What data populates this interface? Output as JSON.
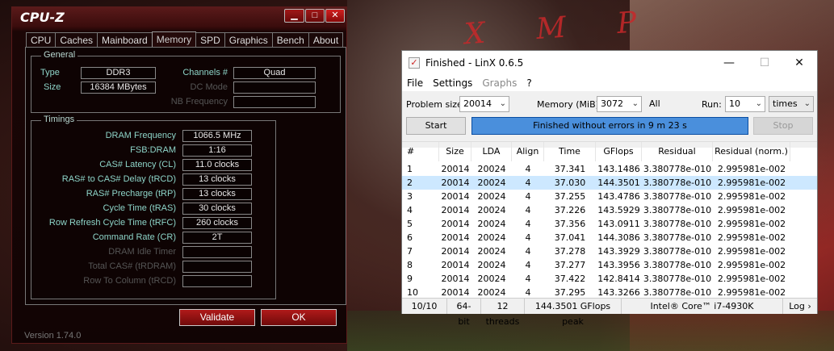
{
  "desktop": {
    "scrawl": "X M P"
  },
  "cpuz": {
    "title": "CPU-Z",
    "window_buttons": {
      "minimize": "▁",
      "maximize": "□",
      "close": "✕"
    },
    "tabs": [
      "CPU",
      "Caches",
      "Mainboard",
      "Memory",
      "SPD",
      "Graphics",
      "Bench",
      "About"
    ],
    "active_tab": "Memory",
    "general": {
      "title": "General",
      "type_label": "Type",
      "type_value": "DDR3",
      "size_label": "Size",
      "size_value": "16384 MBytes",
      "channels_label": "Channels #",
      "channels_value": "Quad",
      "dc_mode_label": "DC Mode",
      "dc_mode_value": "",
      "nb_freq_label": "NB Frequency",
      "nb_freq_value": ""
    },
    "timings": {
      "title": "Timings",
      "rows": [
        {
          "label": "DRAM Frequency",
          "value": "1066.5 MHz",
          "enabled": true
        },
        {
          "label": "FSB:DRAM",
          "value": "1:16",
          "enabled": true
        },
        {
          "label": "CAS# Latency (CL)",
          "value": "11.0 clocks",
          "enabled": true
        },
        {
          "label": "RAS# to CAS# Delay (tRCD)",
          "value": "13 clocks",
          "enabled": true
        },
        {
          "label": "RAS# Precharge (tRP)",
          "value": "13 clocks",
          "enabled": true
        },
        {
          "label": "Cycle Time (tRAS)",
          "value": "30 clocks",
          "enabled": true
        },
        {
          "label": "Row Refresh Cycle Time (tRFC)",
          "value": "260 clocks",
          "enabled": true
        },
        {
          "label": "Command Rate (CR)",
          "value": "2T",
          "enabled": true
        },
        {
          "label": "DRAM Idle Timer",
          "value": "",
          "enabled": false
        },
        {
          "label": "Total CAS# (tRDRAM)",
          "value": "",
          "enabled": false
        },
        {
          "label": "Row To Column (tRCD)",
          "value": "",
          "enabled": false
        }
      ]
    },
    "validate_label": "Validate",
    "ok_label": "OK",
    "version": "Version 1.74.0"
  },
  "linx": {
    "title": "Finished - LinX 0.6.5",
    "app_icon": "check-icon",
    "window_buttons": {
      "minimize": "—",
      "maximize": "☐",
      "close": "✕"
    },
    "menu": [
      {
        "label": "File",
        "enabled": true
      },
      {
        "label": "Settings",
        "enabled": true
      },
      {
        "label": "Graphs",
        "enabled": false
      },
      {
        "label": "?",
        "enabled": true
      }
    ],
    "problem_size_label": "Problem size:",
    "problem_size_value": "20014",
    "memory_label": "Memory (MiB):",
    "memory_value": "3072",
    "all_label": "All",
    "run_label": "Run:",
    "run_value": "10",
    "run_unit": "times",
    "start_label": "Start",
    "stop_label": "Stop",
    "progress_text": "Finished without errors in 9 m 23 s",
    "progress_fraction": 1.0,
    "columns": [
      "#",
      "Size",
      "LDA",
      "Align",
      "Time",
      "GFlops",
      "Residual",
      "Residual (norm.)"
    ],
    "rows": [
      [
        "1",
        "20014",
        "20024",
        "4",
        "37.341",
        "143.1486",
        "3.380778e-010",
        "2.995981e-002"
      ],
      [
        "2",
        "20014",
        "20024",
        "4",
        "37.030",
        "144.3501",
        "3.380778e-010",
        "2.995981e-002"
      ],
      [
        "3",
        "20014",
        "20024",
        "4",
        "37.255",
        "143.4786",
        "3.380778e-010",
        "2.995981e-002"
      ],
      [
        "4",
        "20014",
        "20024",
        "4",
        "37.226",
        "143.5929",
        "3.380778e-010",
        "2.995981e-002"
      ],
      [
        "5",
        "20014",
        "20024",
        "4",
        "37.356",
        "143.0911",
        "3.380778e-010",
        "2.995981e-002"
      ],
      [
        "6",
        "20014",
        "20024",
        "4",
        "37.041",
        "144.3086",
        "3.380778e-010",
        "2.995981e-002"
      ],
      [
        "7",
        "20014",
        "20024",
        "4",
        "37.278",
        "143.3929",
        "3.380778e-010",
        "2.995981e-002"
      ],
      [
        "8",
        "20014",
        "20024",
        "4",
        "37.277",
        "143.3956",
        "3.380778e-010",
        "2.995981e-002"
      ],
      [
        "9",
        "20014",
        "20024",
        "4",
        "37.422",
        "142.8414",
        "3.380778e-010",
        "2.995981e-002"
      ],
      [
        "10",
        "20014",
        "20024",
        "4",
        "37.295",
        "143.3266",
        "3.380778e-010",
        "2.995981e-002"
      ]
    ],
    "selected_row": 1,
    "status": {
      "runs": "10/10",
      "bits": "64-bit",
      "threads": "12 threads",
      "peak": "144.3501 GFlops peak",
      "cpu": "Intel® Core™ i7-4930K",
      "log": "Log ›"
    }
  }
}
